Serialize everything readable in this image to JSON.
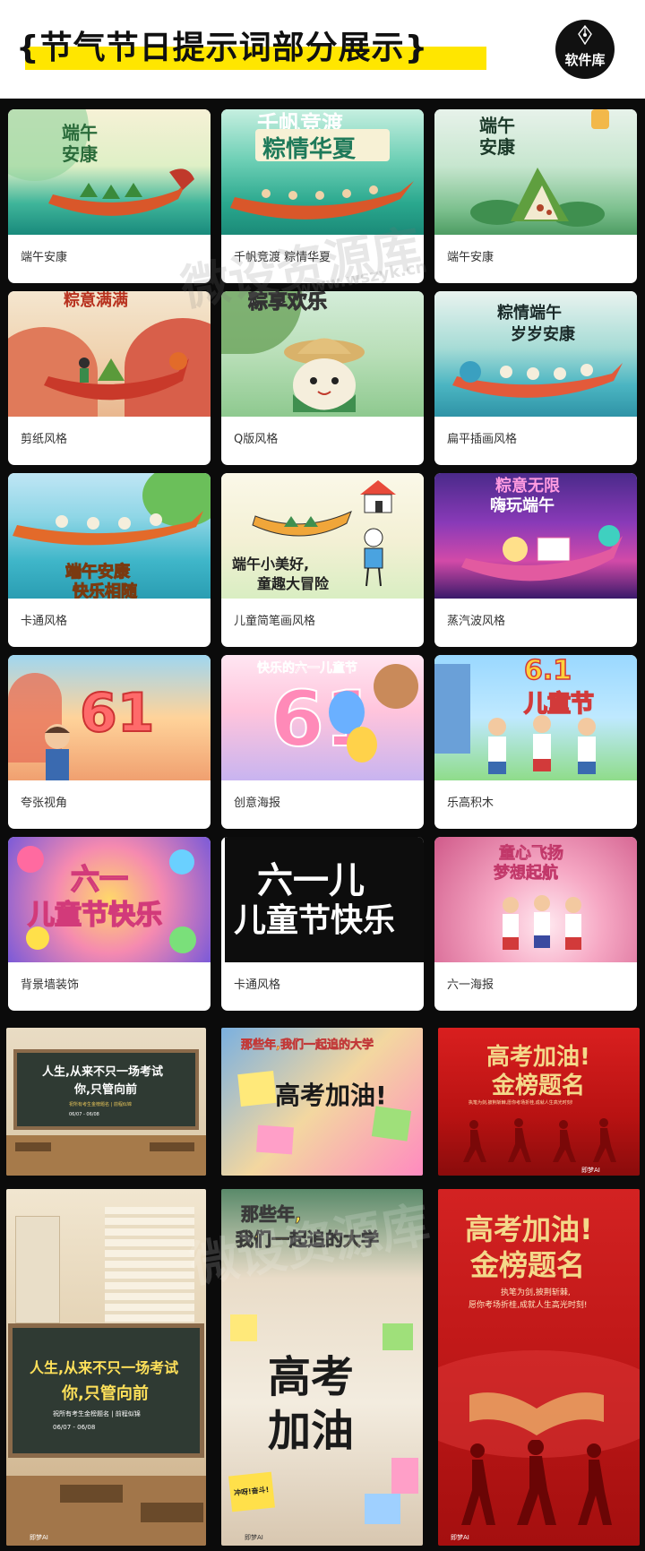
{
  "header": {
    "title": "{节气节日提示词部分展示}",
    "logo_name": "软件库"
  },
  "cards": [
    {
      "caption": "端午安康",
      "art_text": "端午\n安康"
    },
    {
      "caption": "千帆竞渡 粽情华夏",
      "art_text": "千帆竞渡",
      "art_text2": "粽情华夏"
    },
    {
      "caption": "端午安康",
      "art_text": "端午\n安康"
    },
    {
      "caption": "剪纸风格",
      "art_text": "粽意满满"
    },
    {
      "caption": "Q版风格",
      "art_text": "粽享欢乐"
    },
    {
      "caption": "扁平插画风格",
      "art_text": "粽情端午",
      "art_text2": "岁岁安康"
    },
    {
      "caption": "卡通风格",
      "art_text": "端午安康",
      "art_text2": "快乐相随"
    },
    {
      "caption": "儿童简笔画风格",
      "art_text": "端午小美好,",
      "art_text2": "童趣大冒险"
    },
    {
      "caption": "蒸汽波风格",
      "art_text": "粽意无限",
      "art_text2": "嗨玩端午"
    },
    {
      "caption": "夸张视角",
      "art_text": "61"
    },
    {
      "caption": "创意海报",
      "art_text": "快乐的六一儿童节",
      "art_text2": "61"
    },
    {
      "caption": "乐高积木",
      "art_text": "6.1",
      "art_text2": "儿童节"
    },
    {
      "caption": "背景墙装饰",
      "art_text": "六一",
      "art_text2": "儿童节快乐"
    },
    {
      "caption": "卡通风格",
      "art_text": "六一儿",
      "art_text2": "儿童节快乐"
    },
    {
      "caption": "六一海报",
      "art_text": "童心飞扬",
      "art_text2": "梦想起航"
    }
  ],
  "posters": {
    "blackboard_small": {
      "line1": "人生,从来不只一场考试",
      "line2": "你,只管向前",
      "note": "祝所有考生金榜题名 | 前程似锦",
      "date": "06/07 - 06/08"
    },
    "notes_small": {
      "line1": "那些年,我们一起追的大学",
      "line2": "高考加油!"
    },
    "red_small": {
      "line1": "高考加油!",
      "line2": "金榜题名",
      "sub": "执笔为剑,披荆斩棘,愿你考场折桂,成就人生高光时刻!"
    },
    "blackboard_large": {
      "line1": "人生,从来不只一场考试",
      "line2": "你,只管向前",
      "note": "祝所有考生金榜题名 | 前程似锦",
      "date": "06/07 - 06/08"
    },
    "notes_large": {
      "line1": "那些年,",
      "line2": "我们一起追的大学",
      "line3": "高考",
      "line4": "加油",
      "sticky": "冲呀!奋斗!"
    },
    "red_large": {
      "line1": "高考加油!",
      "line2": "金榜题名",
      "sub1": "执笔为剑,披荆斩棘,",
      "sub2": "愿你考场折桂,成就人生高光时刻!"
    },
    "brand": "即梦AI"
  },
  "watermark": {
    "text": "微设资源库",
    "url": "www.wszyk.cn"
  },
  "colors": {
    "header_bg": "#ffffff",
    "highlight": "#ffe600",
    "page_bg": "#0b0b0b",
    "card_bg": "#ffffff"
  }
}
